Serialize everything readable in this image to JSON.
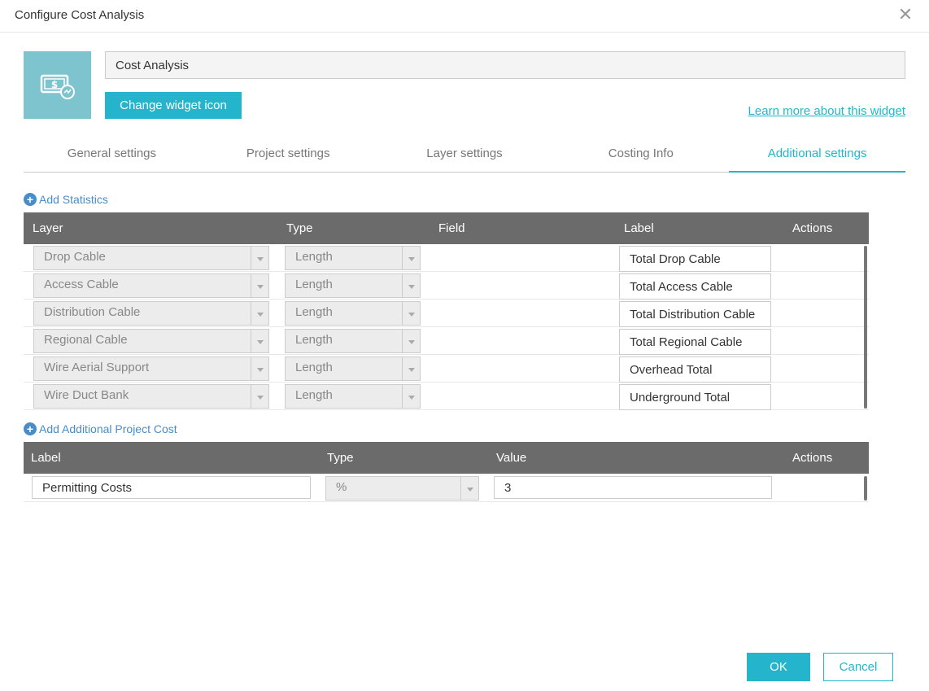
{
  "dialog": {
    "title": "Configure Cost Analysis",
    "close_icon": "close-icon"
  },
  "widget": {
    "icon": "money-icon",
    "name": "Cost Analysis",
    "change_icon_label": "Change widget icon",
    "learn_more_label": "Learn more about this widget"
  },
  "tabs": [
    {
      "label": "General settings",
      "active": false
    },
    {
      "label": "Project settings",
      "active": false
    },
    {
      "label": "Layer settings",
      "active": false
    },
    {
      "label": "Costing Info",
      "active": false
    },
    {
      "label": "Additional settings",
      "active": true
    }
  ],
  "statistics": {
    "add_label": "Add Statistics",
    "headers": {
      "layer": "Layer",
      "type": "Type",
      "field": "Field",
      "label": "Label",
      "actions": "Actions"
    },
    "rows": [
      {
        "layer": "Drop Cable",
        "type": "Length",
        "field": "",
        "label": "Total Drop Cable"
      },
      {
        "layer": "Access Cable",
        "type": "Length",
        "field": "",
        "label": "Total Access Cable"
      },
      {
        "layer": "Distribution Cable",
        "type": "Length",
        "field": "",
        "label": "Total Distribution Cable"
      },
      {
        "layer": "Regional Cable",
        "type": "Length",
        "field": "",
        "label": "Total Regional Cable"
      },
      {
        "layer": "Wire Aerial Support",
        "type": "Length",
        "field": "",
        "label": "Overhead Total"
      },
      {
        "layer": "Wire Duct Bank",
        "type": "Length",
        "field": "",
        "label": "Underground Total"
      }
    ]
  },
  "project_cost": {
    "add_label": "Add Additional Project Cost",
    "headers": {
      "label": "Label",
      "type": "Type",
      "value": "Value",
      "actions": "Actions"
    },
    "rows": [
      {
        "label": "Permitting Costs",
        "type": "%",
        "value": "3"
      }
    ]
  },
  "footer": {
    "ok_label": "OK",
    "cancel_label": "Cancel"
  },
  "colors": {
    "accent": "#24b5cc",
    "icon_bg": "#7ec4cf",
    "table_header": "#6b6b6b",
    "link": "#4a8cc7"
  }
}
